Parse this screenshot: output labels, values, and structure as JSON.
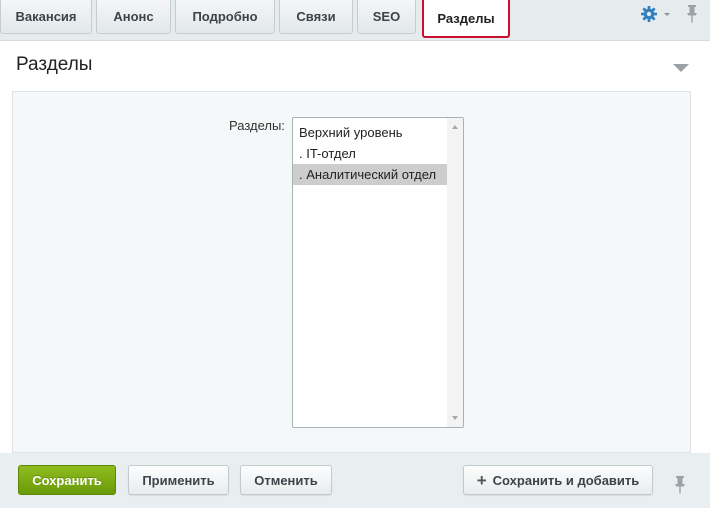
{
  "tabs": [
    {
      "label": "Вакансия"
    },
    {
      "label": "Анонс"
    },
    {
      "label": "Подробно"
    },
    {
      "label": "Связи"
    },
    {
      "label": "SEO"
    },
    {
      "label": "Разделы"
    }
  ],
  "active_tab": "Разделы",
  "toolbar_icons": {
    "settings": "gear-icon",
    "pin": "pin-icon"
  },
  "section": {
    "title": "Разделы"
  },
  "field": {
    "label": "Разделы:",
    "options": [
      {
        "label": "Верхний уровень",
        "selected": false
      },
      {
        "label": ". IT-отдел",
        "selected": false
      },
      {
        "label": ". Аналитический отдел",
        "selected": true
      }
    ]
  },
  "footer": {
    "save_label": "Сохранить",
    "apply_label": "Применить",
    "cancel_label": "Отменить",
    "save_add_label": "Сохранить и добавить"
  },
  "colors": {
    "active_tab_outline": "#c8102e",
    "primary_button": "#7aa812",
    "settings_icon": "#2f7fc1"
  }
}
